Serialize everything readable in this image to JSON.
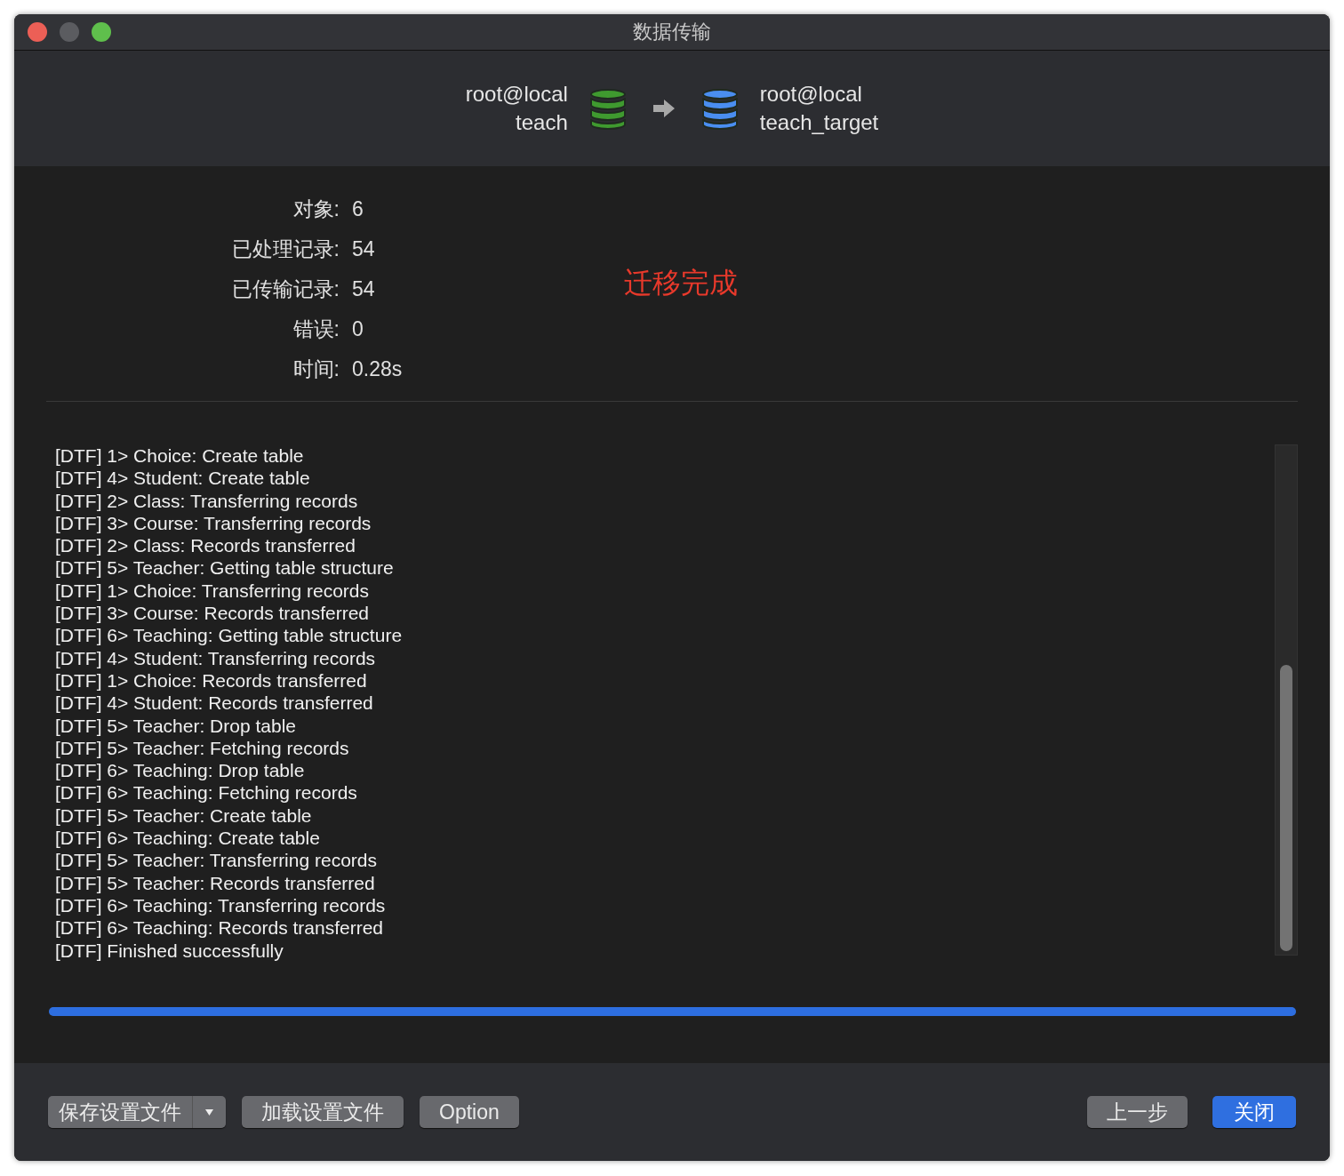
{
  "window": {
    "title": "数据传输"
  },
  "transfer": {
    "source": {
      "server": "root@local",
      "database": "teach"
    },
    "target": {
      "server": "root@local",
      "database": "teach_target"
    }
  },
  "stats": [
    {
      "label": "对象:",
      "value": "6"
    },
    {
      "label": "已处理记录:",
      "value": "54"
    },
    {
      "label": "已传输记录:",
      "value": "54"
    },
    {
      "label": "错误:",
      "value": "0"
    },
    {
      "label": "时间:",
      "value": "0.28s"
    }
  ],
  "status": "迁移完成",
  "log": [
    "[DTF] 1> Choice: Create table",
    "[DTF] 4> Student: Create table",
    "[DTF] 2> Class: Transferring records",
    "[DTF] 3> Course: Transferring records",
    "[DTF] 2> Class: Records transferred",
    "[DTF] 5> Teacher: Getting table structure",
    "[DTF] 1> Choice: Transferring records",
    "[DTF] 3> Course: Records transferred",
    "[DTF] 6> Teaching: Getting table structure",
    "[DTF] 4> Student: Transferring records",
    "[DTF] 1> Choice: Records transferred",
    "[DTF] 4> Student: Records transferred",
    "[DTF] 5> Teacher: Drop table",
    "[DTF] 5> Teacher: Fetching records",
    "[DTF] 6> Teaching: Drop table",
    "[DTF] 6> Teaching: Fetching records",
    "[DTF] 5> Teacher: Create table",
    "[DTF] 6> Teaching: Create table",
    "[DTF] 5> Teacher: Transferring records",
    "[DTF] 5> Teacher: Records transferred",
    "[DTF] 6> Teaching: Transferring records",
    "[DTF] 6> Teaching: Records transferred",
    "[DTF] Finished successfully"
  ],
  "progress": {
    "level": 1
  },
  "buttons_left": [
    {
      "label": "保存设置文件",
      "kind": "split"
    },
    {
      "label": "加载设置文件",
      "kind": "plain"
    },
    {
      "label": "Option",
      "kind": "plain"
    }
  ],
  "buttons_right": [
    {
      "label": "上一步",
      "kind": "plain"
    },
    {
      "label": "关闭",
      "kind": "primary"
    }
  ]
}
